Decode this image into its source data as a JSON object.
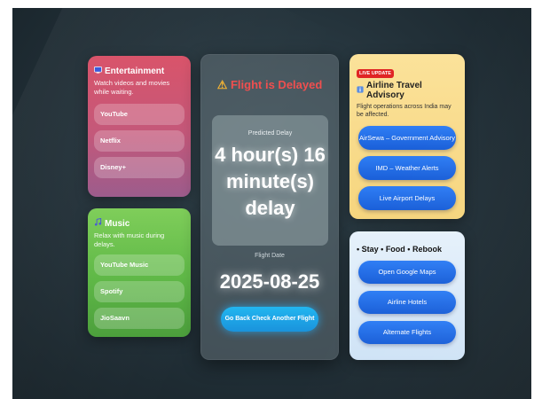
{
  "entertainment": {
    "title": "Entertainment",
    "subtitle": "Watch videos and movies while waiting.",
    "items": [
      "YouTube",
      "Netflix",
      "Disney+"
    ]
  },
  "music": {
    "title": "Music",
    "subtitle": "Relax with music during delays.",
    "items": [
      "YouTube Music",
      "Spotify",
      "JioSaavn"
    ]
  },
  "status": {
    "title": "Flight is Delayed",
    "predicted_label": "Predicted Delay",
    "predicted_value": "4 hour(s) 16 minute(s) delay",
    "date_label": "Flight Date",
    "date_value": "2025-08-25",
    "back_button": "Go Back Check Another Flight"
  },
  "advisory": {
    "badge": "LIVE UPDATE",
    "title": "Airline Travel Advisory",
    "subtitle": "Flight operations across India may be affected.",
    "links": [
      "AirSewa – Government Advisory",
      "IMD – Weather Alerts",
      "Live Airport Delays"
    ]
  },
  "stay": {
    "title": "• Stay • Food • Rebook",
    "links": [
      "Open Google Maps",
      "Airline Hotels",
      "Alternate Flights"
    ]
  },
  "colors": {
    "delay_red": "#ef4f4f",
    "entertainment": "#d9546a",
    "music": "#6cc34f",
    "advisory": "#f8da86",
    "button_blue": "#2a74ee"
  },
  "icons": {
    "entertainment": "tv-icon",
    "music": "music-note-icon",
    "warning": "warning-icon",
    "advisory": "info-icon"
  }
}
